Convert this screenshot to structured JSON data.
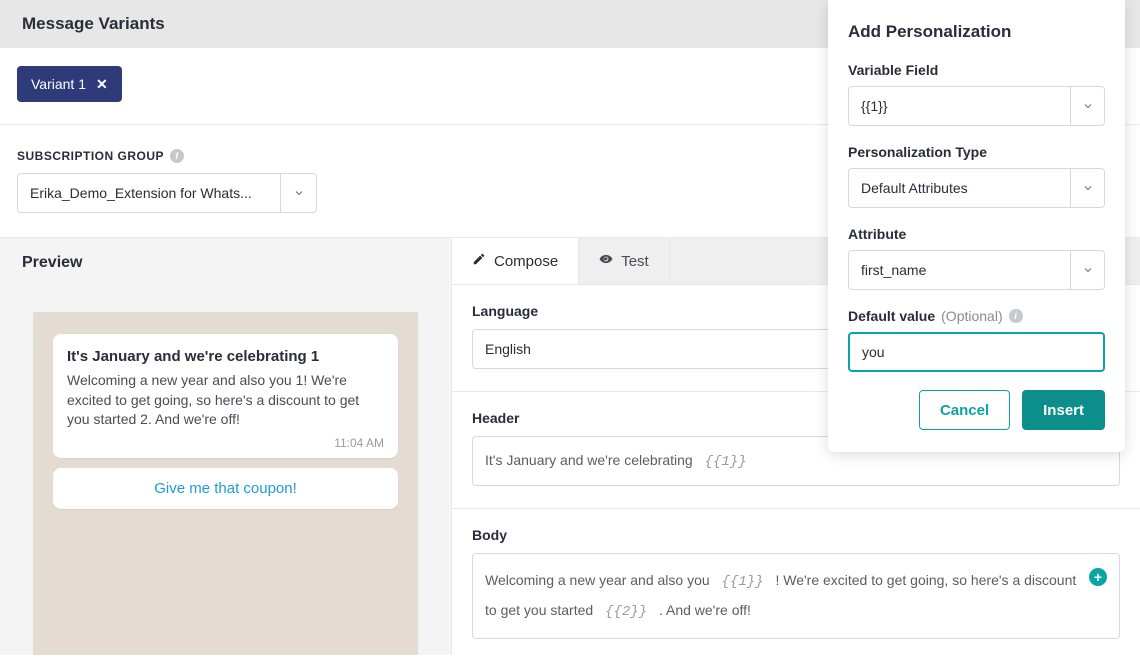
{
  "header": {
    "title": "Message Variants"
  },
  "variant_chip": {
    "label": "Variant 1"
  },
  "subscription": {
    "label": "SUBSCRIPTION GROUP",
    "value": "Erika_Demo_Extension for Whats..."
  },
  "preview": {
    "title": "Preview",
    "bubble_title": "It's January and we're celebrating 1",
    "bubble_body": "Welcoming a new year and also you 1! We're excited to get going, so here's a discount to get you started 2. And we're off!",
    "bubble_time": "11:04 AM",
    "cta": "Give me that coupon!"
  },
  "compose": {
    "tabs": {
      "compose": "Compose",
      "test": "Test"
    },
    "language_label": "Language",
    "language_value": "English",
    "header_label": "Header",
    "header_prefix": "It's January and we're celebrating ",
    "header_token": "{{1}}",
    "body_label": "Body",
    "body_seg1": "Welcoming a new year and also you ",
    "body_token1": "{{1}}",
    "body_seg2": " ! We're excited to get going, so here's a discount to get you started ",
    "body_token2": "{{2}}",
    "body_seg3": " . And we're off!"
  },
  "panel": {
    "title": "Add Personalization",
    "variable_field_label": "Variable Field",
    "variable_field_value": "{{1}}",
    "personalization_type_label": "Personalization Type",
    "personalization_type_value": "Default Attributes",
    "attribute_label": "Attribute",
    "attribute_value": "first_name",
    "default_label": "Default value",
    "default_optional": "(Optional)",
    "default_value": "you",
    "cancel": "Cancel",
    "insert": "Insert"
  }
}
